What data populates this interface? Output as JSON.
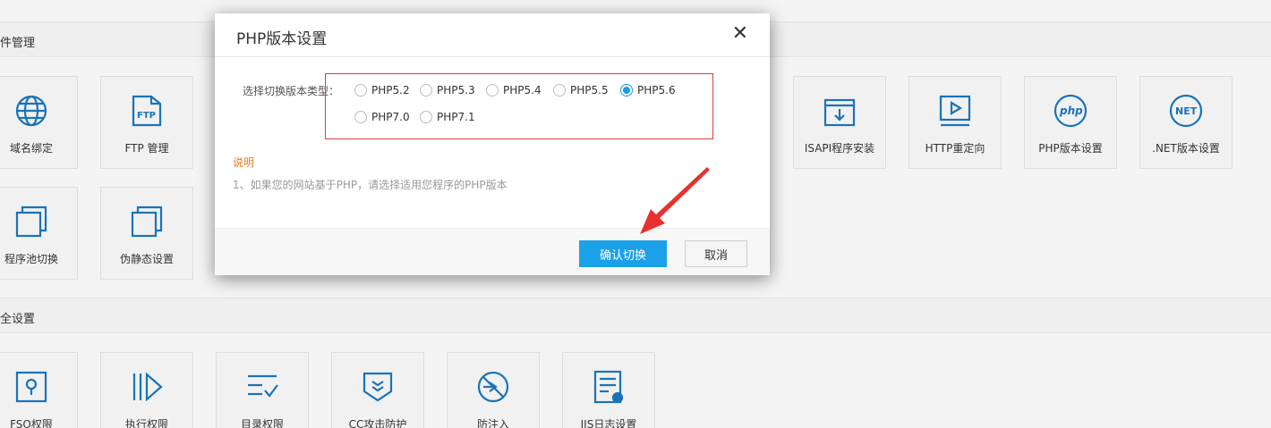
{
  "sections": [
    {
      "title": "件管理"
    },
    {
      "title": "全设置"
    }
  ],
  "tiles": [
    {
      "label": "域名绑定",
      "icon": "globe-icon"
    },
    {
      "label": "FTP 管理",
      "icon": "ftp-folder-icon"
    },
    {
      "label": "ISAPI程序安装",
      "icon": "box-download-icon"
    },
    {
      "label": "HTTP重定向",
      "icon": "play-screen-icon"
    },
    {
      "label": "PHP版本设置",
      "icon": "php-icon"
    },
    {
      "label": ".NET版本设置",
      "icon": "net-icon"
    },
    {
      "label": "程序池切换",
      "icon": "stacked-squares-icon"
    },
    {
      "label": "伪静态设置",
      "icon": "stacked-squares-icon"
    },
    {
      "label": "FSO权限",
      "icon": "key-lock-icon"
    },
    {
      "label": "执行权限",
      "icon": "execute-icon"
    },
    {
      "label": "目录权限",
      "icon": "list-check-icon"
    },
    {
      "label": "CC攻击防护",
      "icon": "shield-icon"
    },
    {
      "label": "防注入",
      "icon": "no-entry-icon"
    },
    {
      "label": "IIS日志设置",
      "icon": "log-document-icon"
    }
  ],
  "modal": {
    "title": "PHP版本设置",
    "close_glyph": "✕",
    "version_label": "选择切换版本类型：",
    "options": [
      {
        "label": "PHP5.2",
        "checked": false
      },
      {
        "label": "PHP5.3",
        "checked": false
      },
      {
        "label": "PHP5.4",
        "checked": false
      },
      {
        "label": "PHP5.5",
        "checked": false
      },
      {
        "label": "PHP5.6",
        "checked": true
      },
      {
        "label": "PHP7.0",
        "checked": false
      },
      {
        "label": "PHP7.1",
        "checked": false
      }
    ],
    "note_title": "说明",
    "note_text": "1、如果您的网站基于PHP，请选择适用您程序的PHP版本",
    "confirm_label": "确认切换",
    "cancel_label": "取消"
  },
  "colors": {
    "accent": "#1ba1e8",
    "icon_blue": "#1a73b8",
    "highlight": "#e03a3a",
    "note": "#e87b1e"
  }
}
